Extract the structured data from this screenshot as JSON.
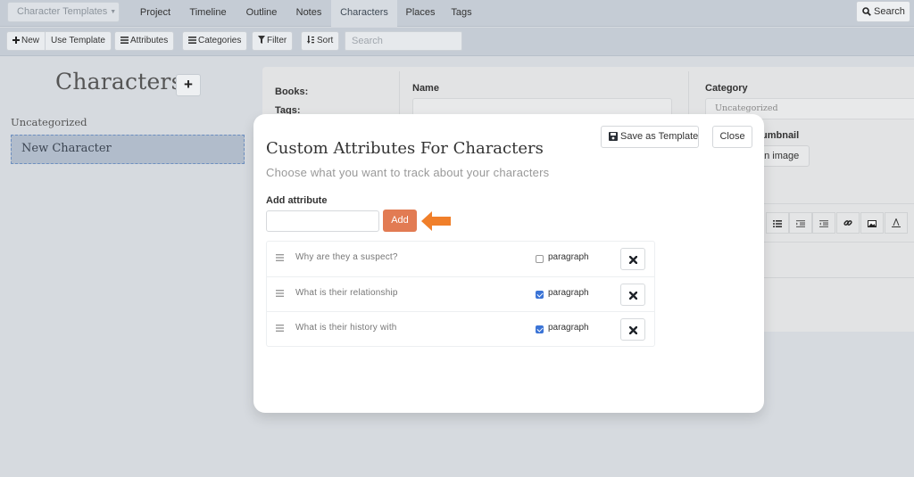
{
  "topnav": {
    "template_dropdown": "Character Templates",
    "tabs": [
      {
        "label": "Project",
        "active": false
      },
      {
        "label": "Timeline",
        "active": false
      },
      {
        "label": "Outline",
        "active": false
      },
      {
        "label": "Notes",
        "active": false
      },
      {
        "label": "Characters",
        "active": true
      },
      {
        "label": "Places",
        "active": false
      },
      {
        "label": "Tags",
        "active": false
      }
    ],
    "search_label": "Search"
  },
  "toolbar": {
    "new_label": "New",
    "use_template_label": "Use Template",
    "attributes_label": "Attributes",
    "categories_label": "Categories",
    "filter_label": "Filter",
    "sort_label": "Sort",
    "search_placeholder": "Search"
  },
  "sidebar": {
    "title": "Characters",
    "add_label": "+",
    "category": "Uncategorized",
    "items": [
      {
        "label": "New Character",
        "selected": true
      }
    ]
  },
  "detail": {
    "books_label": "Books:",
    "tags_label": "Tags:",
    "name_label": "Name",
    "name_value": "",
    "category_label": "Category",
    "category_value": "Uncategorized",
    "thumbnail_label": "Thumbnail",
    "thumbnail_partial": "umbnail",
    "image_button_partial": "an image"
  },
  "modal": {
    "title": "Custom Attributes For Characters",
    "subtitle": "Choose what you want to track about your characters",
    "save_template_label": "Save as Template",
    "close_label": "Close",
    "add_attribute_label": "Add attribute",
    "add_attribute_value": "",
    "add_button_label": "Add",
    "annotation_color": "#f07f2a",
    "accent_color": "#e27b53",
    "attributes": [
      {
        "label": "Why are they a suspect?",
        "type_label": "paragraph",
        "paragraph": false
      },
      {
        "label": "What is their relationship",
        "type_label": "paragraph",
        "paragraph": true
      },
      {
        "label": "What is their history with",
        "type_label": "paragraph",
        "paragraph": true
      }
    ]
  }
}
